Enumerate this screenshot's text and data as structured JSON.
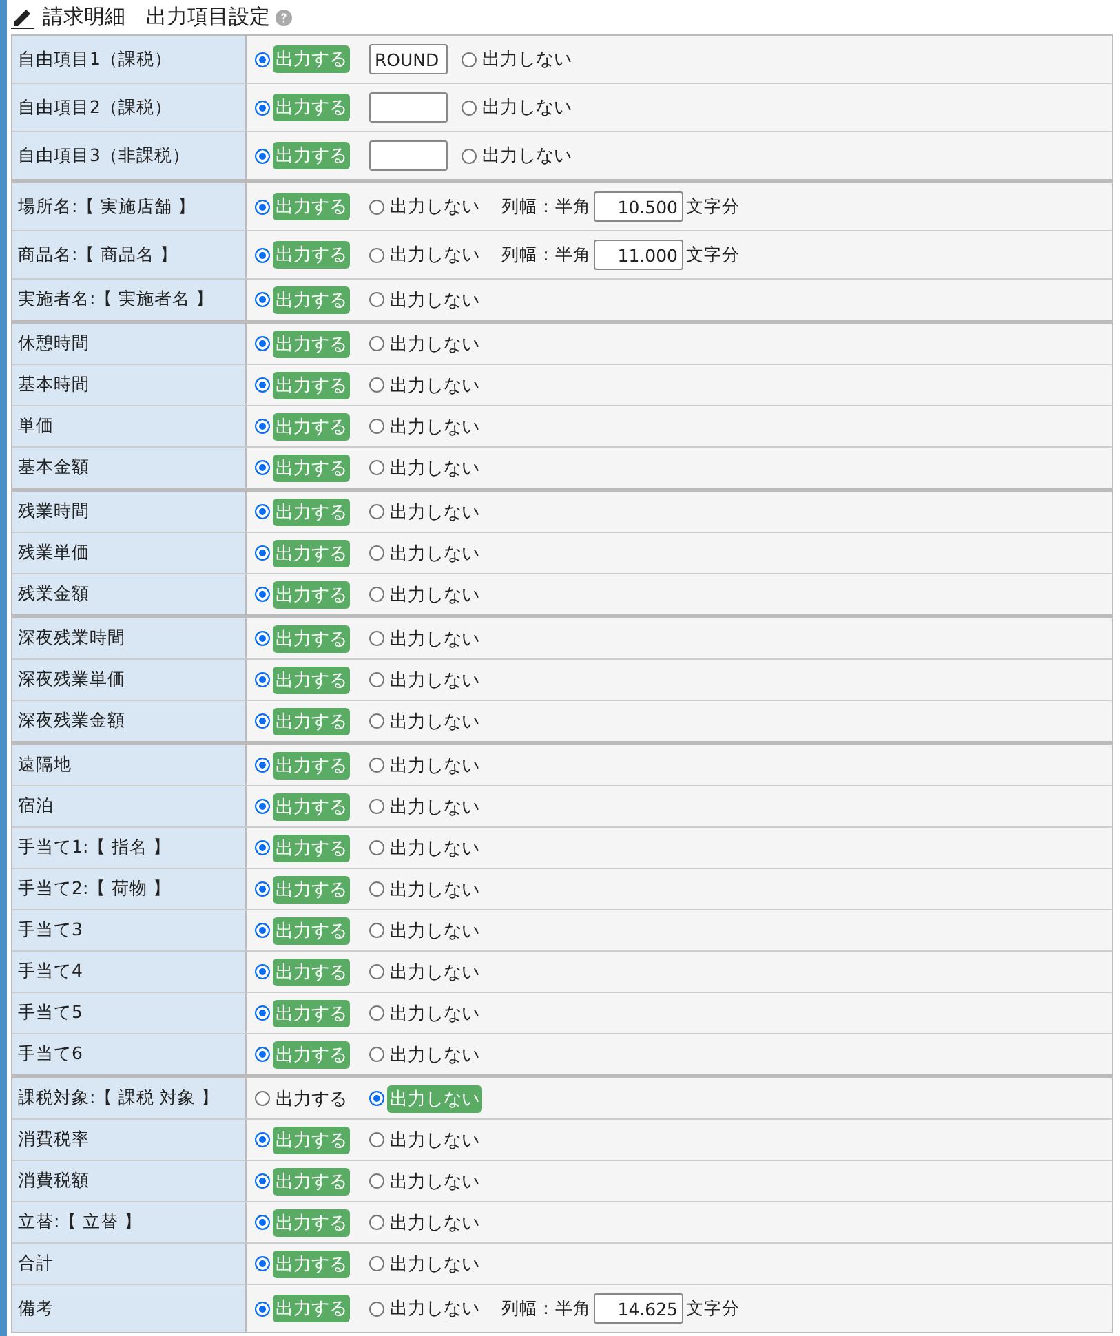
{
  "header": {
    "title": "請求明細　出力項目設定"
  },
  "groups": [
    [
      {
        "label": "自由項目1（課税）",
        "kind": "free",
        "field": {
          "value": "ROUND"
        },
        "options": [
          {
            "label": "出力する",
            "selected": true
          },
          {
            "label": "出力しない",
            "selected": false
          }
        ]
      },
      {
        "label": "自由項目2（課税）",
        "kind": "free",
        "options": [
          {
            "label": "出力する",
            "selected": true
          },
          {
            "label": "出力しない",
            "selected": false
          }
        ]
      },
      {
        "label": "自由項目3（非課税）",
        "kind": "free",
        "options": [
          {
            "label": "出力する",
            "selected": true
          },
          {
            "label": "出力しない",
            "selected": false
          }
        ]
      }
    ],
    [
      {
        "label": "場所名:【 実施店舗 】",
        "kind": "width",
        "width": {
          "prefix": "列幅：半角",
          "value": "10.500",
          "suffix": "文字分"
        },
        "options": [
          {
            "label": "出力する",
            "selected": true
          },
          {
            "label": "出力しない",
            "selected": false
          }
        ]
      },
      {
        "label": "商品名:【 商品名 】",
        "kind": "width",
        "width": {
          "prefix": "列幅：半角",
          "value": "11.000",
          "suffix": "文字分"
        },
        "options": [
          {
            "label": "出力する",
            "selected": true
          },
          {
            "label": "出力しない",
            "selected": false
          }
        ]
      },
      {
        "label": "実施者名:【 実施者名 】",
        "kind": "plain",
        "options": [
          {
            "label": "出力する",
            "selected": true
          },
          {
            "label": "出力しない",
            "selected": false
          }
        ]
      }
    ],
    [
      {
        "label": "休憩時間",
        "kind": "plain",
        "options": [
          {
            "label": "出力する",
            "selected": true
          },
          {
            "label": "出力しない",
            "selected": false
          }
        ]
      },
      {
        "label": "基本時間",
        "kind": "plain",
        "options": [
          {
            "label": "出力する",
            "selected": true
          },
          {
            "label": "出力しない",
            "selected": false
          }
        ]
      },
      {
        "label": "単価",
        "kind": "plain",
        "options": [
          {
            "label": "出力する",
            "selected": true
          },
          {
            "label": "出力しない",
            "selected": false
          }
        ]
      },
      {
        "label": "基本金額",
        "kind": "plain",
        "options": [
          {
            "label": "出力する",
            "selected": true
          },
          {
            "label": "出力しない",
            "selected": false
          }
        ]
      }
    ],
    [
      {
        "label": "残業時間",
        "kind": "plain",
        "options": [
          {
            "label": "出力する",
            "selected": true
          },
          {
            "label": "出力しない",
            "selected": false
          }
        ]
      },
      {
        "label": "残業単価",
        "kind": "plain",
        "options": [
          {
            "label": "出力する",
            "selected": true
          },
          {
            "label": "出力しない",
            "selected": false
          }
        ]
      },
      {
        "label": "残業金額",
        "kind": "plain",
        "options": [
          {
            "label": "出力する",
            "selected": true
          },
          {
            "label": "出力しない",
            "selected": false
          }
        ]
      }
    ],
    [
      {
        "label": "深夜残業時間",
        "kind": "plain",
        "options": [
          {
            "label": "出力する",
            "selected": true
          },
          {
            "label": "出力しない",
            "selected": false
          }
        ]
      },
      {
        "label": "深夜残業単価",
        "kind": "plain",
        "options": [
          {
            "label": "出力する",
            "selected": true
          },
          {
            "label": "出力しない",
            "selected": false
          }
        ]
      },
      {
        "label": "深夜残業金額",
        "kind": "plain",
        "options": [
          {
            "label": "出力する",
            "selected": true
          },
          {
            "label": "出力しない",
            "selected": false
          }
        ]
      }
    ],
    [
      {
        "label": "遠隔地",
        "kind": "plain",
        "options": [
          {
            "label": "出力する",
            "selected": true
          },
          {
            "label": "出力しない",
            "selected": false
          }
        ]
      },
      {
        "label": "宿泊",
        "kind": "plain",
        "options": [
          {
            "label": "出力する",
            "selected": true
          },
          {
            "label": "出力しない",
            "selected": false
          }
        ]
      },
      {
        "label": "手当て1:【 指名 】",
        "kind": "plain",
        "options": [
          {
            "label": "出力する",
            "selected": true
          },
          {
            "label": "出力しない",
            "selected": false
          }
        ]
      },
      {
        "label": "手当て2:【 荷物 】",
        "kind": "plain",
        "options": [
          {
            "label": "出力する",
            "selected": true
          },
          {
            "label": "出力しない",
            "selected": false
          }
        ]
      },
      {
        "label": "手当て3",
        "kind": "plain",
        "options": [
          {
            "label": "出力する",
            "selected": true
          },
          {
            "label": "出力しない",
            "selected": false
          }
        ]
      },
      {
        "label": "手当て4",
        "kind": "plain",
        "options": [
          {
            "label": "出力する",
            "selected": true
          },
          {
            "label": "出力しない",
            "selected": false
          }
        ]
      },
      {
        "label": "手当て5",
        "kind": "plain",
        "options": [
          {
            "label": "出力する",
            "selected": true
          },
          {
            "label": "出力しない",
            "selected": false
          }
        ]
      },
      {
        "label": "手当て6",
        "kind": "plain",
        "options": [
          {
            "label": "出力する",
            "selected": true
          },
          {
            "label": "出力しない",
            "selected": false
          }
        ]
      }
    ],
    [
      {
        "label": "課税対象:【 課税 対象 】",
        "kind": "plain",
        "options": [
          {
            "label": "出力する",
            "selected": false
          },
          {
            "label": "出力しない",
            "selected": true
          }
        ]
      },
      {
        "label": "消費税率",
        "kind": "plain",
        "options": [
          {
            "label": "出力する",
            "selected": true
          },
          {
            "label": "出力しない",
            "selected": false
          }
        ]
      },
      {
        "label": "消費税額",
        "kind": "plain",
        "options": [
          {
            "label": "出力する",
            "selected": true
          },
          {
            "label": "出力しない",
            "selected": false
          }
        ]
      },
      {
        "label": "立替:【 立替 】",
        "kind": "plain",
        "options": [
          {
            "label": "出力する",
            "selected": true
          },
          {
            "label": "出力しない",
            "selected": false
          }
        ]
      },
      {
        "label": "合計",
        "kind": "plain",
        "options": [
          {
            "label": "出力する",
            "selected": true
          },
          {
            "label": "出力しない",
            "selected": false
          }
        ]
      },
      {
        "label": "備考",
        "kind": "width",
        "width": {
          "prefix": "列幅：半角",
          "value": "14.625",
          "suffix": "文字分"
        },
        "options": [
          {
            "label": "出力する",
            "selected": true
          },
          {
            "label": "出力しない",
            "selected": false
          }
        ]
      }
    ]
  ]
}
